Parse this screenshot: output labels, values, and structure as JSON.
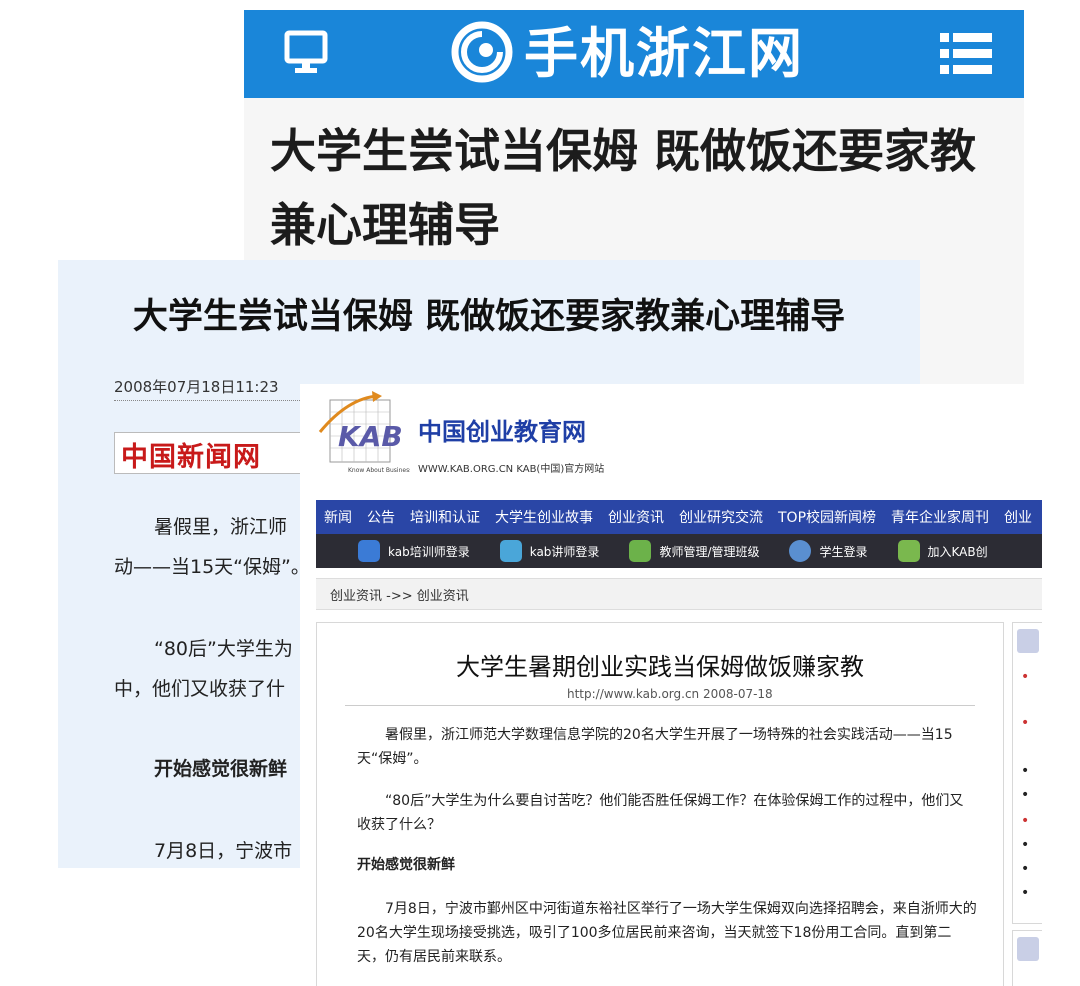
{
  "card_zjol": {
    "brand": "手机浙江网",
    "title": "大学生尝试当保姆 既做饭还要家教兼心理辅导",
    "colors": {
      "header_bg": "#1a86d9"
    }
  },
  "card_chinanews": {
    "title": "大学生尝试当保姆 既做饭还要家教兼心理辅导",
    "date": "2008年07月18日11:23",
    "logo_text": "中国新闻网",
    "paragraphs": [
      "暑假里，浙江师",
      "动——当15天“保姆”。",
      "“80后”大学生为",
      "中，他们又收获了什",
      "开始感觉很新鲜",
      "7月8日，宁波市"
    ],
    "colors": {
      "bg": "#eaf2fb"
    }
  },
  "card_kab": {
    "brand": "中国创业教育网",
    "subtitle": "WWW.KAB.ORG.CN  KAB(中国)官方网站",
    "nav_primary": [
      "新闻",
      "公告",
      "培训和认证",
      "大学生创业故事",
      "创业资讯",
      "创业研究交流",
      "TOP校园新闻榜",
      "青年企业家周刊",
      "创业"
    ],
    "nav_secondary": [
      {
        "label": "kab培训师登录",
        "icon": "trainer-login-icon"
      },
      {
        "label": "kab讲师登录",
        "icon": "lecturer-login-icon"
      },
      {
        "label": "教师管理/管理班级",
        "icon": "teacher-manage-icon"
      },
      {
        "label": "学生登录",
        "icon": "student-login-icon"
      },
      {
        "label": "加入KAB创",
        "icon": "join-kab-icon"
      }
    ],
    "breadcrumb": "创业资讯 ->> 创业资讯",
    "article": {
      "title": "大学生暑期创业实践当保姆做饭赚家教",
      "source": "http://www.kab.org.cn 2008-07-18",
      "paragraphs": [
        "暑假里，浙江师范大学数理信息学院的20名大学生开展了一场特殊的社会实践活动——当15天“保姆”。",
        "“80后”大学生为什么要自讨苦吃？他们能否胜任保姆工作？在体验保姆工作的过程中，他们又收获了什么？",
        "开始感觉很新鲜",
        "7月8日，宁波市鄞州区中河街道东裕社区举行了一场大学生保姆双向选择招聘会，来自浙师大的20名大学生现场接受挑选，吸引了100多位居民前来咨询，当天就签下18份用工合同。直到第二天，仍有居民前来联系。"
      ]
    },
    "colors": {
      "nav_primary_bg": "#2a46a6",
      "nav_secondary_bg": "#2c2c34",
      "brand": "#1f3fa6"
    }
  }
}
